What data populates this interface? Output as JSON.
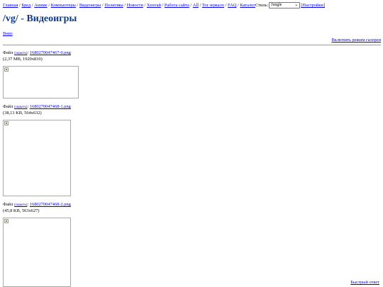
{
  "nav": {
    "links": [
      "Главная",
      "Бред",
      "Аниме",
      "Компьютеры",
      "Видеоигры",
      "Политика",
      "Новости",
      "Хентай",
      "Работа сайта",
      "All",
      "Tor зеркало",
      "FAQ",
      "Каталог"
    ],
    "style_label": "Стиль:",
    "style_value": "Jungle",
    "settings_label": "[Настройки]"
  },
  "page_title": "/vg/ - Видеоигры",
  "down_link": "Вниз",
  "gallery_link": "Включить режим галереи",
  "files": [
    {
      "prefix": "Файл",
      "hide": "(скрыть)",
      "name": "1680270047467-0.png",
      "info": "(2,37 MB, 1920x810)"
    },
    {
      "prefix": "Файл",
      "hide": "(скрыть)",
      "name": "1680270047468-1.png",
      "info": "(38,13 KB, 564x632)"
    },
    {
      "prefix": "Файл",
      "hide": "(скрыть)",
      "name": "1680270047468-2.png",
      "info": "(45,8 KB, 563x627)"
    }
  ],
  "quick_reply": "Быстрый ответ"
}
